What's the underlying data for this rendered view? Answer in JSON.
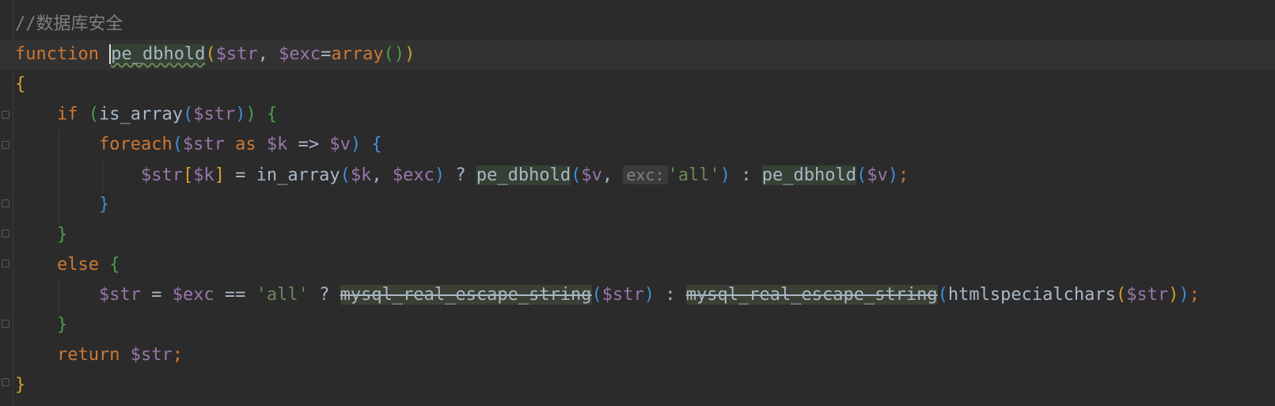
{
  "editor": {
    "lines": [
      {
        "id": "l1",
        "tokens": [
          {
            "t": "//数据库安全",
            "c": "cmt"
          }
        ]
      },
      {
        "id": "l2",
        "tokens": [
          {
            "t": "function",
            "c": "kw"
          },
          {
            "t": " ",
            "c": "punc"
          },
          {
            "t": "pe_dbhold",
            "c": "fn caret squiggle hl"
          },
          {
            "t": "(",
            "c": "br1"
          },
          {
            "t": "$str",
            "c": "var"
          },
          {
            "t": ", ",
            "c": "punc"
          },
          {
            "t": "$exc",
            "c": "var"
          },
          {
            "t": "=",
            "c": "punc"
          },
          {
            "t": "array",
            "c": "kw"
          },
          {
            "t": "(",
            "c": "br2"
          },
          {
            "t": ")",
            "c": "br2"
          },
          {
            "t": ")",
            "c": "br1"
          }
        ]
      },
      {
        "id": "l3",
        "tokens": [
          {
            "t": "{",
            "c": "br1"
          }
        ]
      },
      {
        "id": "l4",
        "tokens": [
          {
            "t": "    ",
            "c": "punc"
          },
          {
            "t": "if",
            "c": "kw"
          },
          {
            "t": " ",
            "c": "punc"
          },
          {
            "t": "(",
            "c": "br2"
          },
          {
            "t": "is_array",
            "c": "fn"
          },
          {
            "t": "(",
            "c": "br3"
          },
          {
            "t": "$str",
            "c": "var"
          },
          {
            "t": ")",
            "c": "br3"
          },
          {
            "t": ")",
            "c": "br2"
          },
          {
            "t": " ",
            "c": "punc"
          },
          {
            "t": "{",
            "c": "br2"
          }
        ]
      },
      {
        "id": "l5",
        "tokens": [
          {
            "t": "        ",
            "c": "punc"
          },
          {
            "t": "foreach",
            "c": "kw"
          },
          {
            "t": "(",
            "c": "br3"
          },
          {
            "t": "$str",
            "c": "var"
          },
          {
            "t": " ",
            "c": "punc"
          },
          {
            "t": "as",
            "c": "kw"
          },
          {
            "t": " ",
            "c": "punc"
          },
          {
            "t": "$k",
            "c": "var"
          },
          {
            "t": " => ",
            "c": "punc"
          },
          {
            "t": "$v",
            "c": "var"
          },
          {
            "t": ")",
            "c": "br3"
          },
          {
            "t": " ",
            "c": "punc"
          },
          {
            "t": "{",
            "c": "br3"
          }
        ]
      },
      {
        "id": "l6",
        "tokens": [
          {
            "t": "            ",
            "c": "punc"
          },
          {
            "t": "$str",
            "c": "var"
          },
          {
            "t": "[",
            "c": "br1"
          },
          {
            "t": "$k",
            "c": "var"
          },
          {
            "t": "]",
            "c": "br1"
          },
          {
            "t": " = ",
            "c": "punc"
          },
          {
            "t": "in_array",
            "c": "fn"
          },
          {
            "t": "(",
            "c": "br3"
          },
          {
            "t": "$k",
            "c": "var"
          },
          {
            "t": ", ",
            "c": "punc"
          },
          {
            "t": "$exc",
            "c": "var"
          },
          {
            "t": ")",
            "c": "br3"
          },
          {
            "t": " ? ",
            "c": "punc"
          },
          {
            "t": "pe_dbhold",
            "c": "fn hl"
          },
          {
            "t": "(",
            "c": "br3"
          },
          {
            "t": "$v",
            "c": "var"
          },
          {
            "t": ", ",
            "c": "punc"
          },
          {
            "t": "exc:",
            "c": "hint"
          },
          {
            "t": "'all'",
            "c": "str"
          },
          {
            "t": ")",
            "c": "br3"
          },
          {
            "t": " : ",
            "c": "punc"
          },
          {
            "t": "pe_dbhold",
            "c": "fn hl"
          },
          {
            "t": "(",
            "c": "br3"
          },
          {
            "t": "$v",
            "c": "var"
          },
          {
            "t": ")",
            "c": "br3"
          },
          {
            "t": ";",
            "c": "semi"
          }
        ]
      },
      {
        "id": "l7",
        "tokens": [
          {
            "t": "        ",
            "c": "punc"
          },
          {
            "t": "}",
            "c": "br3"
          }
        ]
      },
      {
        "id": "l8",
        "tokens": [
          {
            "t": "    ",
            "c": "punc"
          },
          {
            "t": "}",
            "c": "br2"
          }
        ]
      },
      {
        "id": "l9",
        "tokens": [
          {
            "t": "    ",
            "c": "punc"
          },
          {
            "t": "else",
            "c": "kw"
          },
          {
            "t": " ",
            "c": "punc"
          },
          {
            "t": "{",
            "c": "br2"
          }
        ]
      },
      {
        "id": "l10",
        "tokens": [
          {
            "t": "        ",
            "c": "punc"
          },
          {
            "t": "$str",
            "c": "var"
          },
          {
            "t": " = ",
            "c": "punc"
          },
          {
            "t": "$exc",
            "c": "var"
          },
          {
            "t": " == ",
            "c": "punc"
          },
          {
            "t": "'all'",
            "c": "str"
          },
          {
            "t": " ? ",
            "c": "punc"
          },
          {
            "t": "mysql_real_escape_string",
            "c": "fn hl-dep"
          },
          {
            "t": "(",
            "c": "br3 hl-dep-bg"
          },
          {
            "t": "$str",
            "c": "var"
          },
          {
            "t": ")",
            "c": "br3"
          },
          {
            "t": " : ",
            "c": "punc"
          },
          {
            "t": "mysql_real_escape_string",
            "c": "fn hl-dep"
          },
          {
            "t": "(",
            "c": "br3"
          },
          {
            "t": "htmlspecialchars",
            "c": "fn"
          },
          {
            "t": "(",
            "c": "br1"
          },
          {
            "t": "$str",
            "c": "var"
          },
          {
            "t": ")",
            "c": "br1"
          },
          {
            "t": ")",
            "c": "br3"
          },
          {
            "t": ";",
            "c": "semi"
          }
        ]
      },
      {
        "id": "l11",
        "tokens": [
          {
            "t": "    ",
            "c": "punc"
          },
          {
            "t": "}",
            "c": "br2"
          }
        ]
      },
      {
        "id": "l12",
        "tokens": [
          {
            "t": "    ",
            "c": "punc"
          },
          {
            "t": "return",
            "c": "kw"
          },
          {
            "t": " ",
            "c": "punc"
          },
          {
            "t": "$str",
            "c": "var"
          },
          {
            "t": ";",
            "c": "semi"
          }
        ]
      },
      {
        "id": "l13",
        "tokens": [
          {
            "t": "}",
            "c": "br1"
          }
        ]
      }
    ]
  }
}
